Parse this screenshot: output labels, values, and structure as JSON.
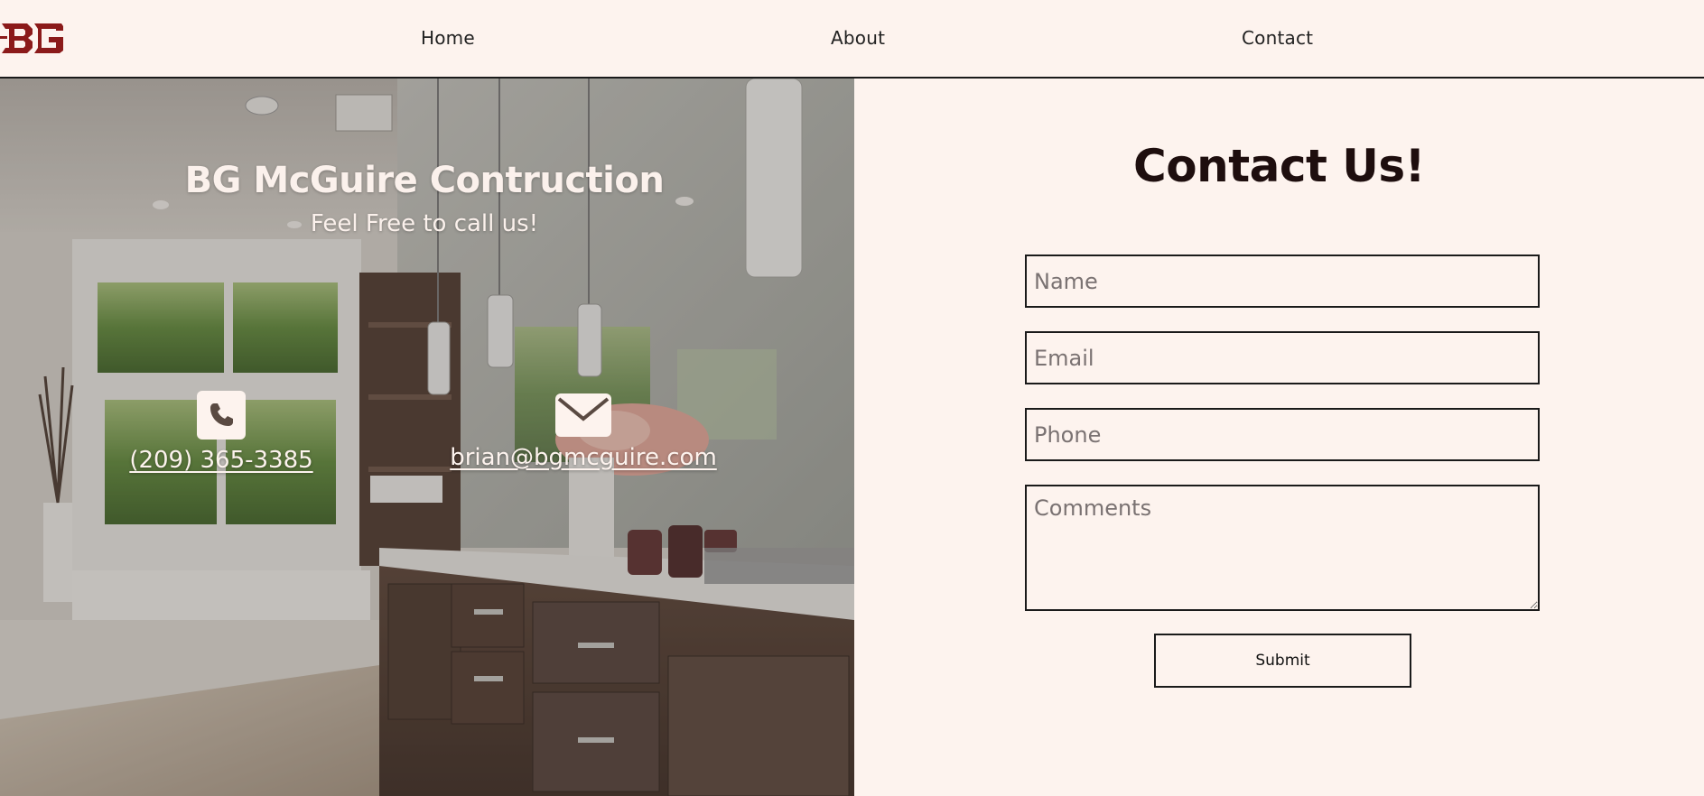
{
  "brand": {
    "logo_text": "BG",
    "logo_color": "#8b1a1a"
  },
  "nav": {
    "home_label": "Home",
    "about_label": "About",
    "contact_label": "Contact"
  },
  "hero": {
    "title": "BG McGuire Contruction",
    "subtitle": "Feel Free to call us!",
    "phone_icon": "phone-icon",
    "phone": "(209) 365-3385",
    "email_icon": "envelope-icon",
    "email": "brian@bgmcguire.com"
  },
  "form": {
    "title": "Contact Us!",
    "name_placeholder": "Name",
    "email_placeholder": "Email",
    "phone_placeholder": "Phone",
    "comments_placeholder": "Comments",
    "submit_label": "Submit"
  },
  "colors": {
    "background": "#fdf3ee",
    "text": "#1a0d0d",
    "border": "#1a1a1a"
  }
}
